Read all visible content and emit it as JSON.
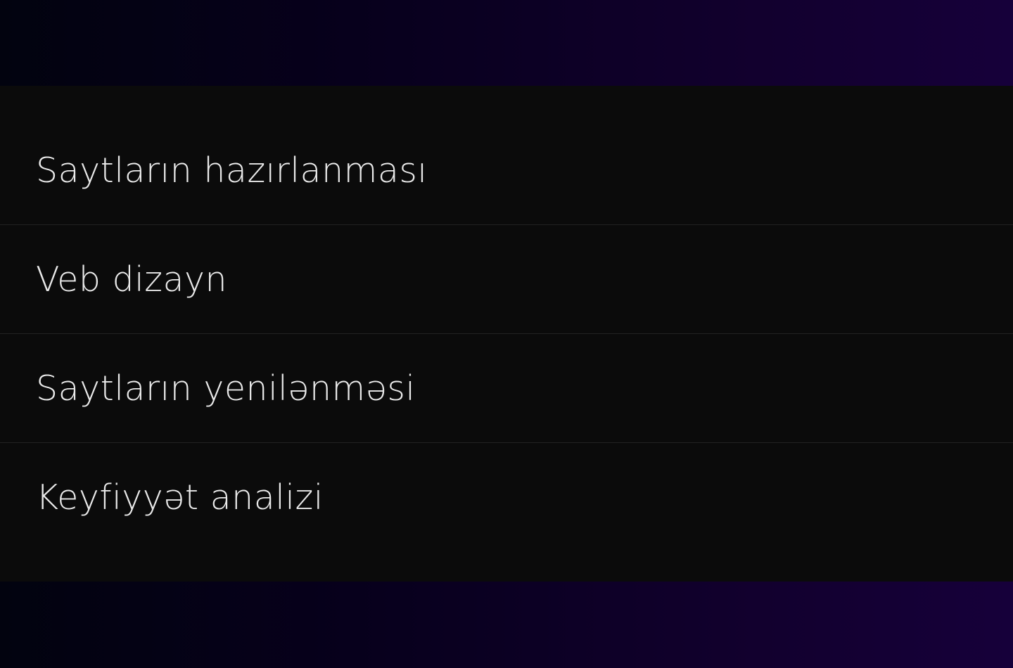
{
  "menu": {
    "items": [
      {
        "label": "Saytların hazırlanması"
      },
      {
        "label": "Veb dizayn"
      },
      {
        "label": "Saytların yenilənməsi"
      },
      {
        "label": "Keyfiyyət analizi"
      }
    ]
  },
  "colors": {
    "panel_background": "#0b0b0b",
    "text": "#eaeaea",
    "divider": "#222222",
    "gradient_start": "#02030f",
    "gradient_end": "#16003a"
  }
}
